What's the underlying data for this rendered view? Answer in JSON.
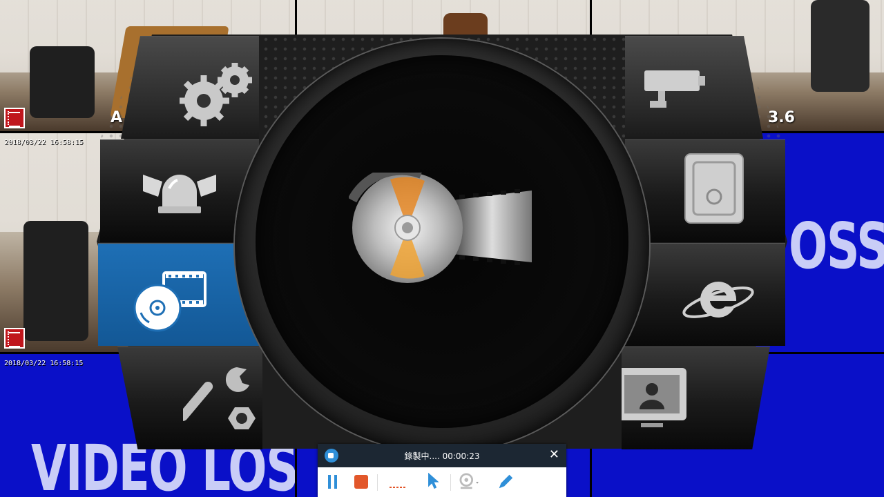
{
  "cameras": {
    "top_overlay_labels": {
      "left_fragment": "A",
      "right_fragment": "3.6"
    },
    "timestamps": [
      "2018/03/22 16:58:15",
      "2018/03/22 16:58:15"
    ],
    "video_loss_label": "VIDEO LOSS",
    "video_loss_partial": "OSS",
    "video_loss_partial_bottom": "LOSS"
  },
  "menu": {
    "items": [
      {
        "id": "setup",
        "icon": "gears-icon"
      },
      {
        "id": "alarm",
        "icon": "alarm-siren-icon"
      },
      {
        "id": "playback",
        "icon": "playback-disc-icon",
        "active": true
      },
      {
        "id": "tools",
        "icon": "wrench-nut-icon"
      },
      {
        "id": "camera",
        "icon": "camera-icon"
      },
      {
        "id": "hdd",
        "icon": "hard-disk-icon"
      },
      {
        "id": "network",
        "icon": "internet-explorer-icon"
      },
      {
        "id": "display",
        "icon": "monitor-user-icon"
      }
    ],
    "center_icon": "disc-film-icon",
    "accent_color": "#1e6fb5"
  },
  "recorder": {
    "title": "錄製中.... 00:00:23",
    "close": "✕",
    "tools": [
      "pause-icon",
      "stop-icon",
      "dots-icon",
      "cursor-highlight-icon",
      "webcam-icon",
      "pen-icon"
    ],
    "stop_color": "#e2572a",
    "tool_color": "#2f8fd8"
  }
}
